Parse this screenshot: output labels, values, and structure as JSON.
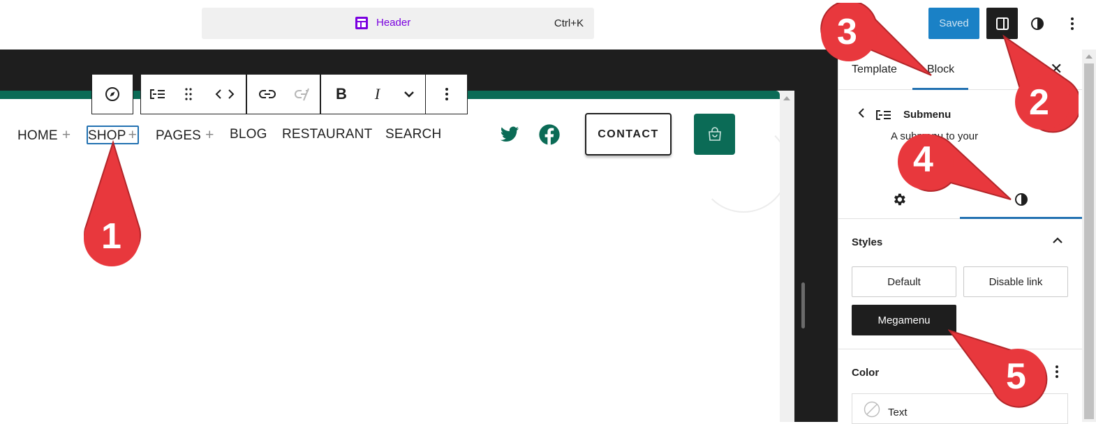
{
  "topbar": {
    "command": {
      "title": "Header",
      "shortcut": "Ctrl+K"
    },
    "saved_label": "Saved",
    "icons": [
      "layout-icon",
      "sidebar-toggle-icon",
      "half-circle-styles-icon",
      "kebab-menu-icon"
    ]
  },
  "block_toolbar": {
    "icons": [
      "compass-icon",
      "submenu-icon",
      "drag-handle-icon",
      "code-arrows-icon",
      "link-icon",
      "unlink-icon",
      "bold-icon",
      "italic-icon",
      "chevron-down-icon",
      "more-options-icon"
    ],
    "bold_glyph": "B",
    "italic_glyph": "I"
  },
  "nav": {
    "items": [
      {
        "label": "HOME",
        "plus": "+"
      },
      {
        "label": "SHOP",
        "plus": "+"
      },
      {
        "label": "PAGES",
        "plus": "+"
      },
      {
        "label": "BLOG"
      },
      {
        "label": "RESTAURANT"
      },
      {
        "label": "SEARCH"
      }
    ],
    "contact_label": "CONTACT",
    "social": [
      "twitter-icon",
      "facebook-icon"
    ],
    "accent": "#0b6b56"
  },
  "sidebar": {
    "tabs": [
      "Template",
      "Block"
    ],
    "active_tab": "Block",
    "close_glyph": "✕",
    "block": {
      "name": "Submenu",
      "description": "A submenu to your"
    },
    "inspector_tabs": [
      "gear-icon",
      "half-circle-styles-icon"
    ],
    "styles": {
      "heading": "Styles",
      "options": [
        "Default",
        "Disable link",
        "Megamenu"
      ],
      "selected": "Megamenu"
    },
    "color": {
      "heading": "Color",
      "items": [
        "Text"
      ]
    }
  },
  "annotations": {
    "numbers": [
      "1",
      "2",
      "3",
      "4",
      "5"
    ],
    "color": "#e8383d"
  }
}
